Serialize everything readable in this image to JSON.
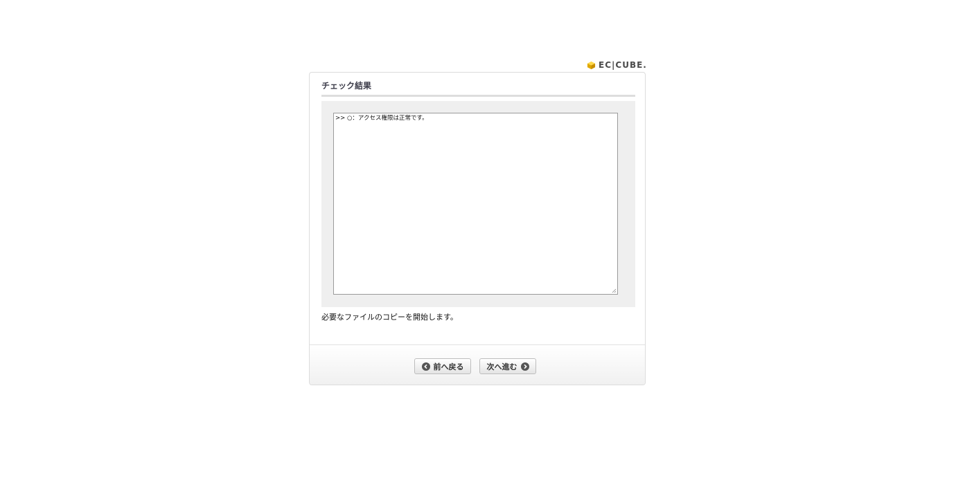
{
  "header": {
    "logo_text": "EC|CUBE."
  },
  "panel": {
    "title": "チェック結果",
    "result_text": ">> ○：アクセス権限は正常です。",
    "message": "必要なファイルのコピーを開始します。"
  },
  "footer": {
    "back_label": "前へ戻る",
    "next_label": "次へ進む"
  },
  "icons": {
    "logo": "cube-icon",
    "back": "arrow-left-circle-icon",
    "next": "arrow-right-circle-icon",
    "resize": "resize-grip-icon"
  },
  "colors": {
    "logo_cube": "#f2c200",
    "button_icon": "#555555",
    "result_background": "#efefef"
  }
}
